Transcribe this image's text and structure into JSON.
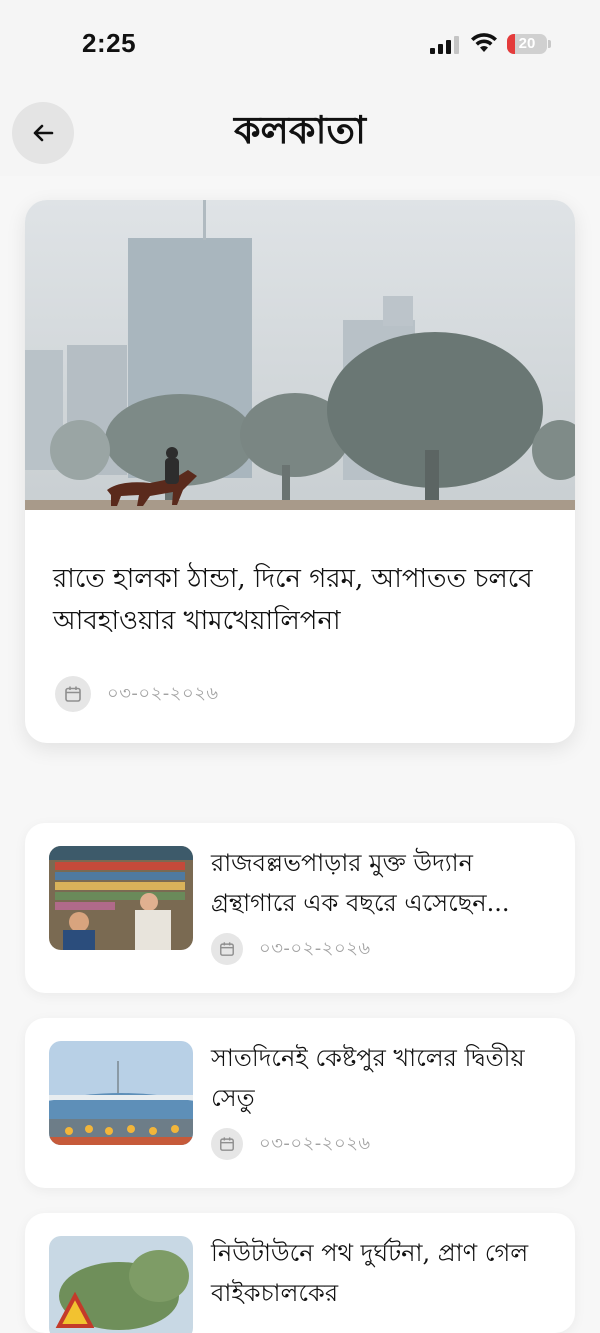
{
  "status_bar": {
    "time": "2:25",
    "battery": "20",
    "battery_level": 0.2,
    "battery_color": "#e43b3b"
  },
  "header": {
    "title": "কলকাতা",
    "back_icon": "arrow-left-icon"
  },
  "featured": {
    "title": "রাতে হালকা ঠান্ডা, দিনে গরম, আপাতত চলবে আবহাওয়ার খামখেয়ালিপনা",
    "date": "০৩-০২-২০২৬",
    "image": "foggy-kolkata-skyline-horse-rider"
  },
  "articles": [
    {
      "title": "রাজবল্লভপাড়ার মুক্ত উদ্যান গ্রন্থাগারে এক বছরে এসেছেন...",
      "date": "০৩-০২-২০২৬",
      "image": "open-air-library-bookshelves"
    },
    {
      "title": "সাতদিনেই কেষ্টপুর খালের দ্বিতীয় সেতু",
      "date": "০৩-০২-২০২৬",
      "image": "bridge-construction-workers"
    },
    {
      "title": "নিউটাউনে পথ দুর্ঘটনা, প্রাণ গেল বাইকচালকের",
      "date": "",
      "image": "road-warning-sign-trees"
    }
  ],
  "colors": {
    "background": "#f7f7f7",
    "card": "#ffffff",
    "date_text": "#a2a2a2"
  }
}
